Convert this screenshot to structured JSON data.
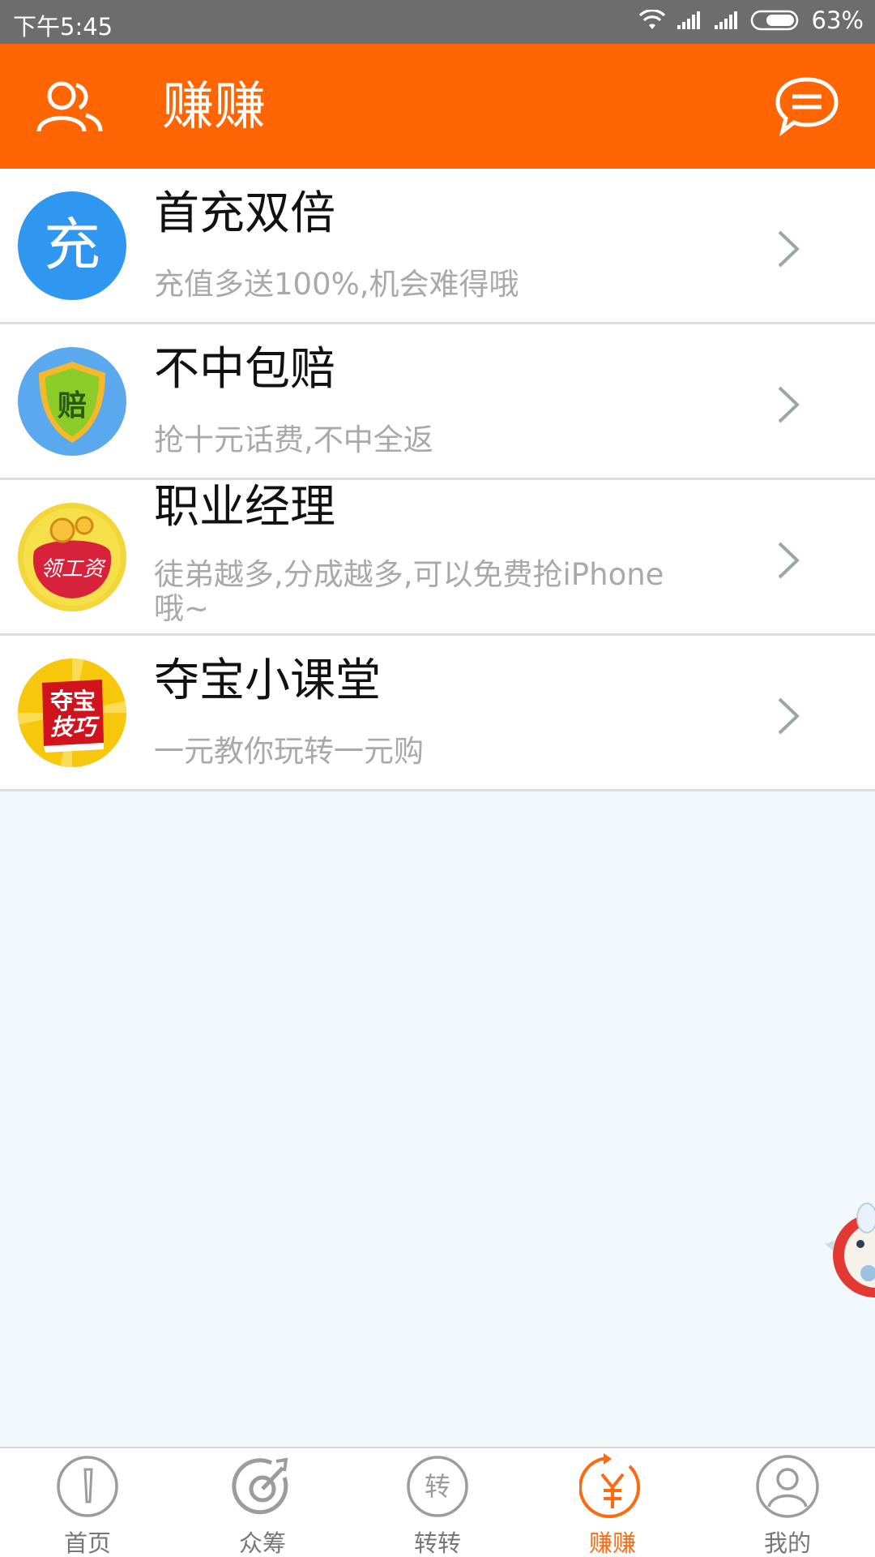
{
  "status_bar": {
    "time": "下午5:45",
    "battery": "63%"
  },
  "header": {
    "title": "赚赚"
  },
  "items": [
    {
      "title": "首充双倍",
      "subtitle": "充值多送100%,机会难得哦",
      "icon_text": "充"
    },
    {
      "title": "不中包赔",
      "subtitle": "抢十元话费,不中全返",
      "icon_text": "赔"
    },
    {
      "title": "职业经理",
      "subtitle": "徒弟越多,分成越多,可以免费抢iPhone哦~",
      "icon_text": "领工资"
    },
    {
      "title": "夺宝小课堂",
      "subtitle": "一元教你玩转一元购",
      "icon_text_1": "夺宝",
      "icon_text_2": "技巧"
    }
  ],
  "tabs": [
    {
      "label": "首页",
      "icon": "home-icon"
    },
    {
      "label": "众筹",
      "icon": "crowdfund-icon"
    },
    {
      "label": "转转",
      "icon": "transfer-icon"
    },
    {
      "label": "赚赚",
      "icon": "earn-icon"
    },
    {
      "label": "我的",
      "icon": "profile-icon"
    }
  ],
  "colors": {
    "accent": "#ff6603",
    "active_tab": "#ff6a10",
    "background": "#f2f9fd"
  }
}
